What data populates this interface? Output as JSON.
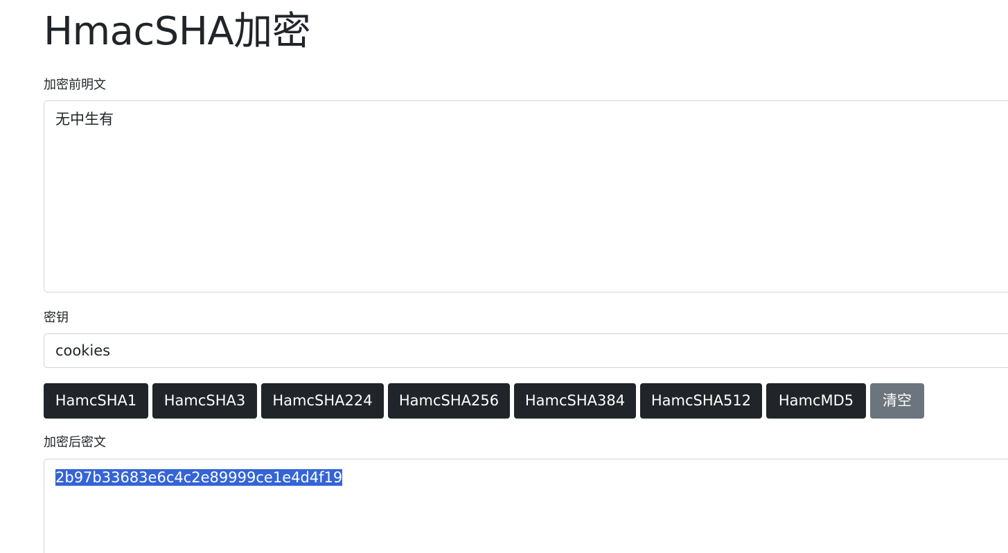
{
  "page": {
    "title": "HmacSHA加密"
  },
  "plaintext": {
    "label": "加密前明文",
    "value": "无中生有"
  },
  "key": {
    "label": "密钥",
    "value": "cookies"
  },
  "buttons": {
    "b1": "HamcSHA1",
    "b2": "HamcSHA3",
    "b3": "HamcSHA224",
    "b4": "HamcSHA256",
    "b5": "HamcSHA384",
    "b6": "HamcSHA512",
    "b7": "HamcMD5",
    "clear": "清空"
  },
  "ciphertext": {
    "label": "加密后密文",
    "value": "2b97b33683e6c4c2e89999ce1e4d4f19"
  },
  "colors": {
    "dark_button": "#212529",
    "clear_button": "#6c757d",
    "selection": "#3464d6"
  }
}
